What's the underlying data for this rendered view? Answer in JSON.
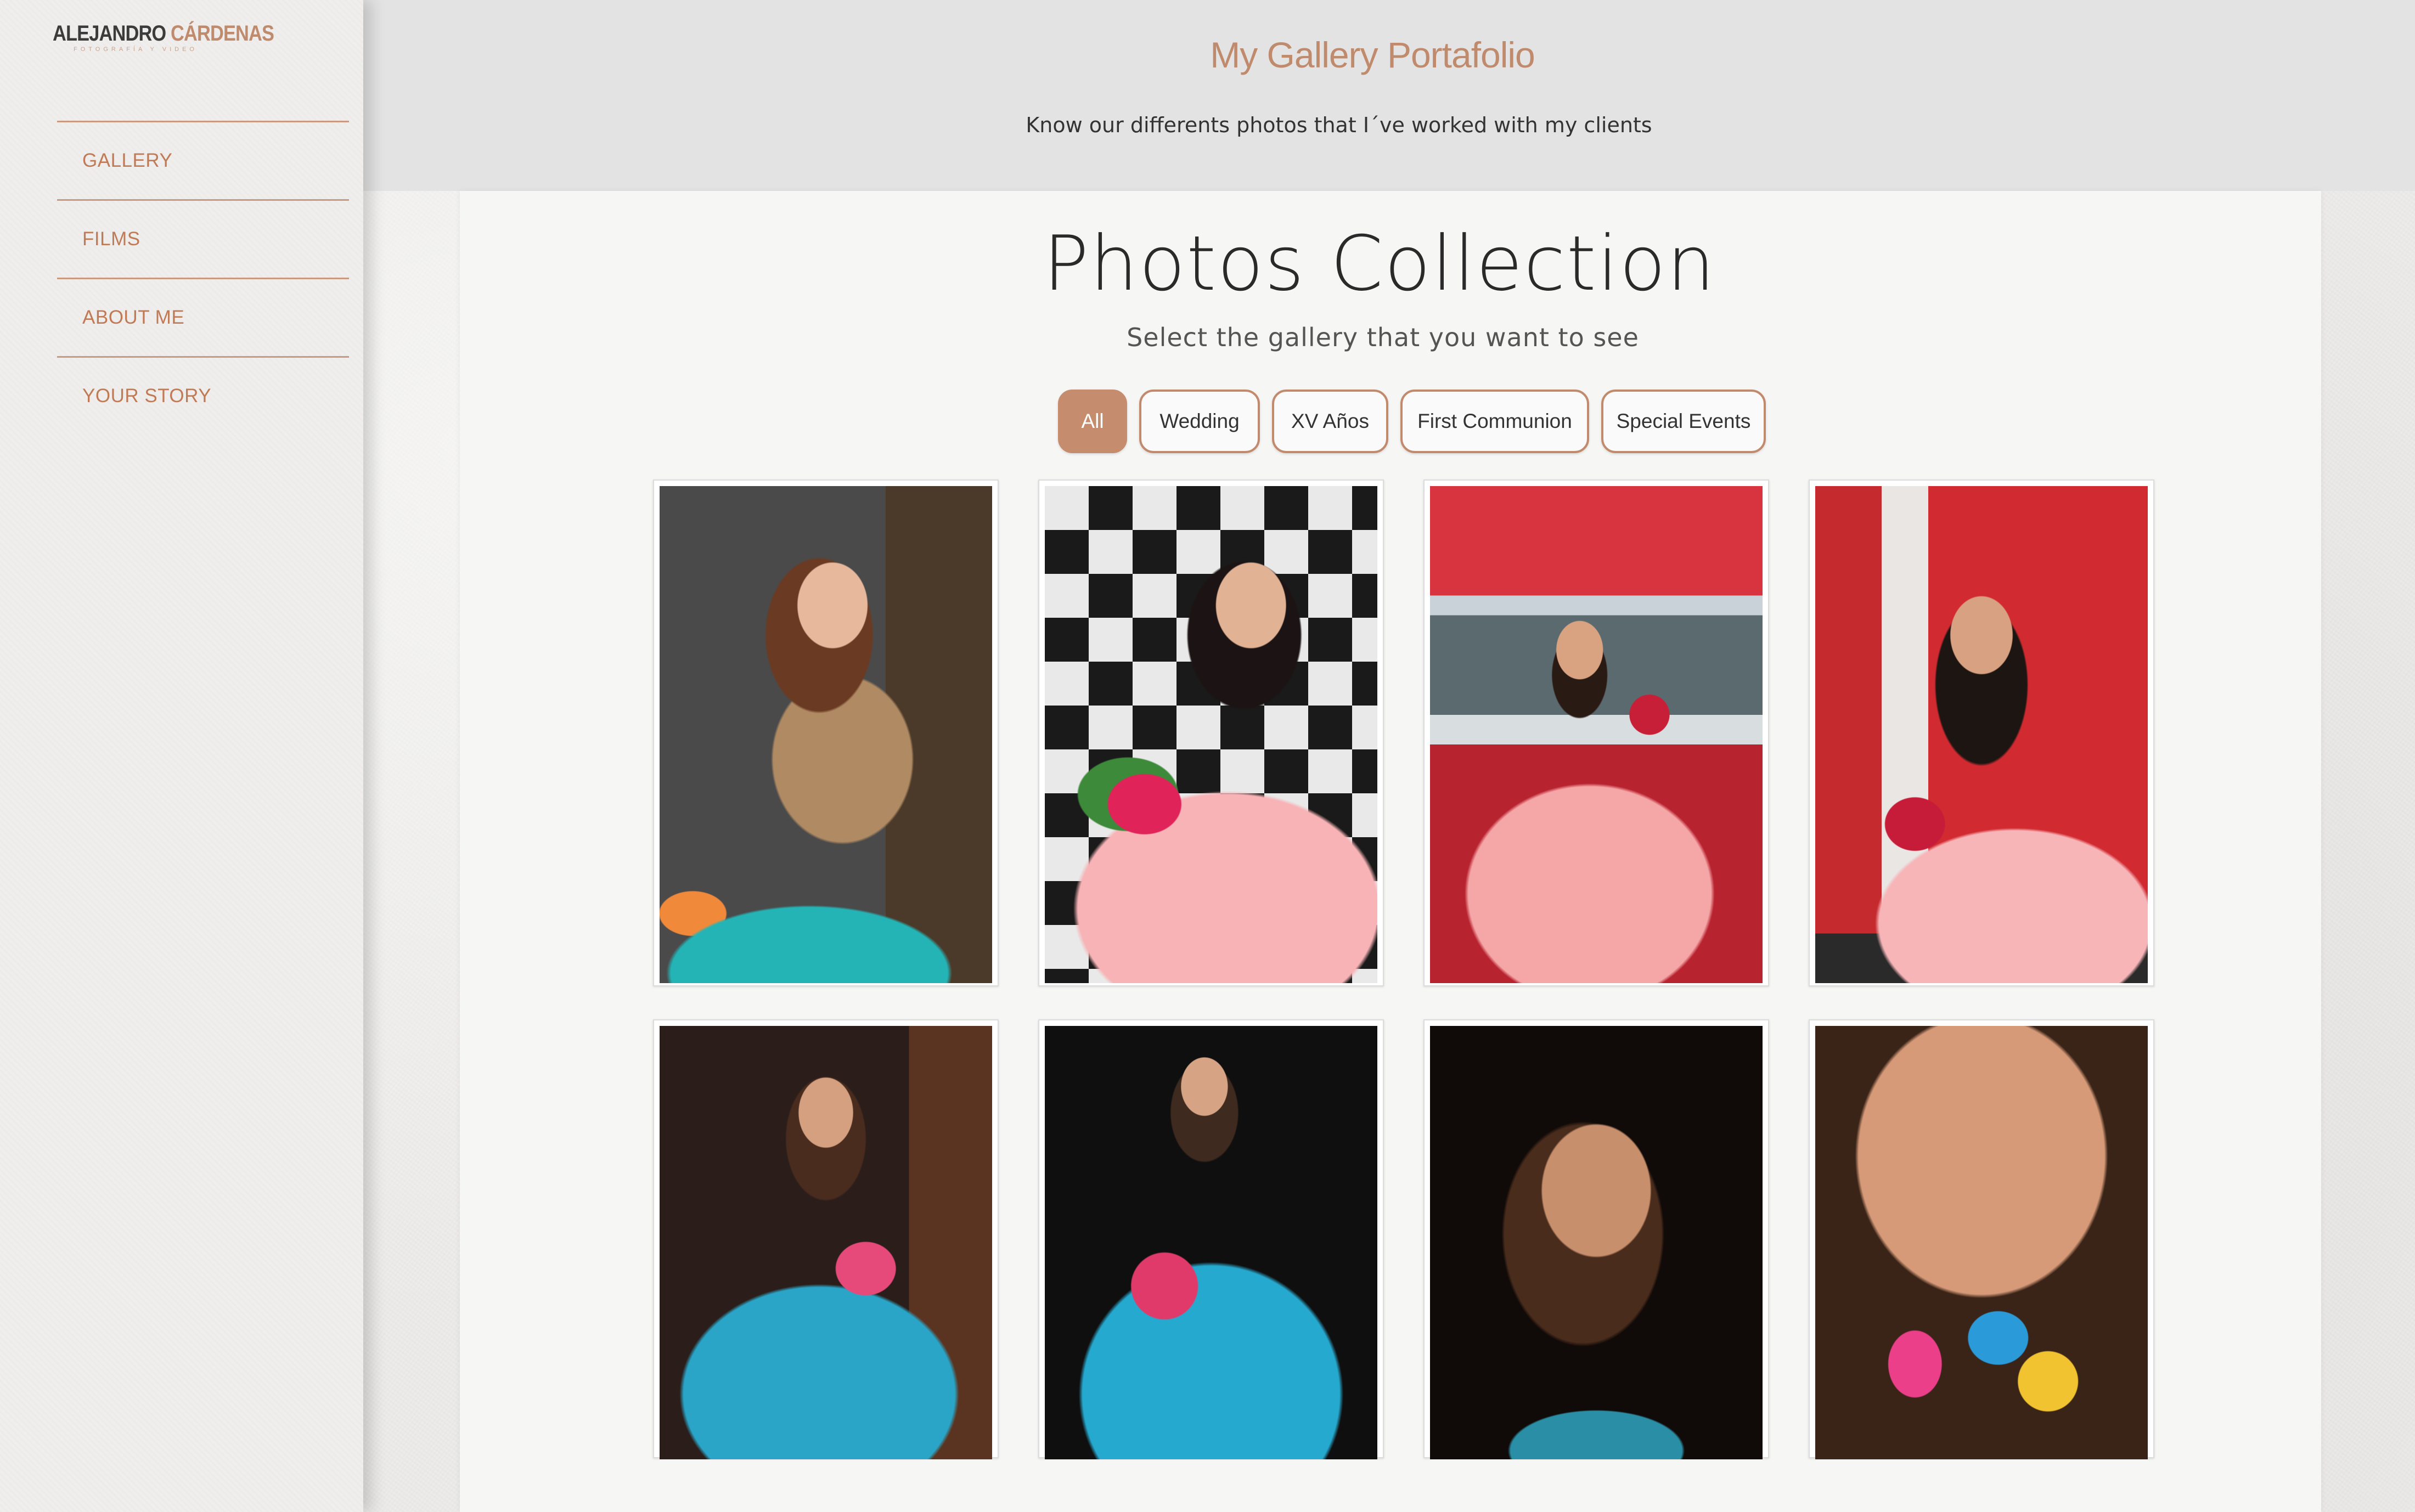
{
  "brand": {
    "first": "ALEJANDRO",
    "last": "CÁRDENAS",
    "tagline": "FOTOGRAFÍA Y VIDEO"
  },
  "sidebar": {
    "items": [
      {
        "label": "GALLERY"
      },
      {
        "label": "FILMS"
      },
      {
        "label": "ABOUT ME"
      },
      {
        "label": "YOUR STORY"
      }
    ]
  },
  "header": {
    "title": "My Gallery Portafolio",
    "subtitle": "Know our differents photos that I´ve worked with my clients"
  },
  "main": {
    "title": "Photos Collection",
    "subtitle": "Select the gallery that you want to see",
    "filters": [
      {
        "label": "All",
        "active": true
      },
      {
        "label": "Wedding",
        "active": false
      },
      {
        "label": "XV Años",
        "active": false
      },
      {
        "label": "First Communion",
        "active": false
      },
      {
        "label": "Special Events",
        "active": false
      }
    ]
  },
  "colors": {
    "accent": "#c68c6e",
    "nav_text": "#c07a55",
    "header_bg": "#e3e3e3"
  }
}
